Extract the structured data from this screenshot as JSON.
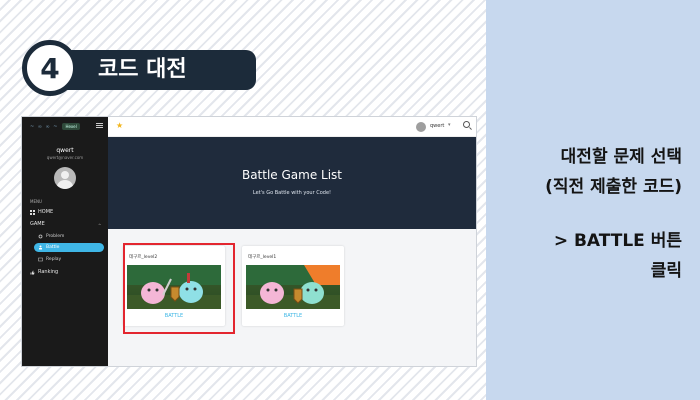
{
  "step": {
    "number": "4",
    "title": "코드 대전"
  },
  "instructions": {
    "line1": "대전할 문제 선택",
    "line2": "(직전 제출한 코드)",
    "line3": "> BATTLE 버튼",
    "line4": "클릭"
  },
  "app": {
    "sidebar": {
      "logo": "~ ∞ ∞ ~",
      "badge": "Hexel",
      "username": "qwert",
      "email": "qwert@naver.com",
      "menu_label": "MENU",
      "home": "HOME",
      "game_label": "GAME",
      "problem": "Problem",
      "battle": "Battle",
      "replay": "Replay",
      "ranking": "Ranking"
    },
    "topbar": {
      "username": "qwert"
    },
    "hero": {
      "title": "Battle Game List",
      "subtitle": "Let's Go Battle with your Code!"
    },
    "cards": [
      {
        "title": "데구르_level2",
        "button": "BATTLE"
      },
      {
        "title": "데구르_level1",
        "button": "BATTLE"
      }
    ]
  },
  "colors": {
    "highlight": "#e3262f",
    "active_nav": "#3fb6e6",
    "hero_bg": "#1f2b3c",
    "panel_bg": "#c7d8ee"
  }
}
